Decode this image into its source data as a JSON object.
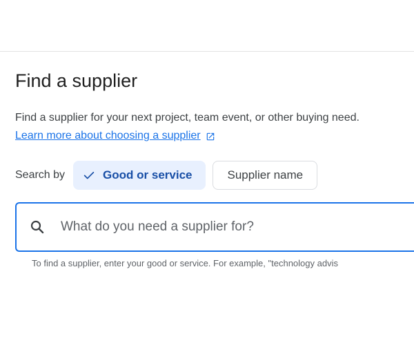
{
  "page": {
    "title": "Find a supplier",
    "description": "Find a supplier for your next project, team event, or other buying need.",
    "learn_more_link": "Learn more about choosing a supplier"
  },
  "search_by": {
    "label": "Search by",
    "options": [
      {
        "label": "Good or service",
        "selected": true
      },
      {
        "label": "Supplier name",
        "selected": false
      }
    ]
  },
  "search": {
    "placeholder": "What do you need a supplier for?",
    "value": "",
    "helper_text": "To find a supplier, enter your good or service. For example, \"technology advis"
  },
  "icons": {
    "external_link": "external-link-icon",
    "check": "check-icon",
    "search": "search-icon"
  },
  "colors": {
    "accent": "#1a73e8",
    "selected_chip_bg": "#e8f0fe",
    "selected_chip_text": "#174ea6",
    "link": "#1a73e8"
  }
}
